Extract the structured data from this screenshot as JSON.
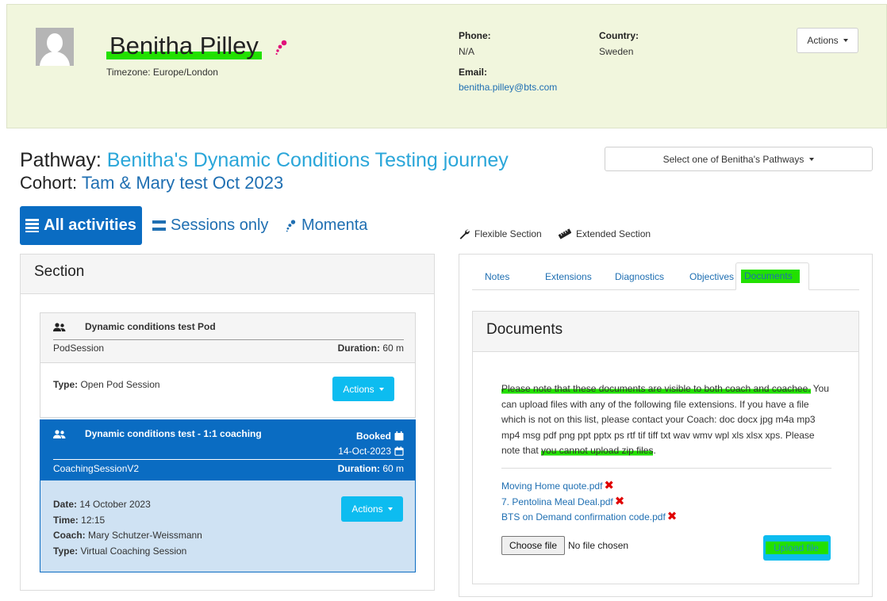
{
  "profile": {
    "name": "Benitha Pilley",
    "timezone": "Timezone: Europe/London",
    "phone_label": "Phone:",
    "phone_value": "N/A",
    "country_label": "Country:",
    "country_value": "Sweden",
    "email_label": "Email:",
    "email_value": "benitha.pilley@bts.com",
    "actions_label": "Actions"
  },
  "pathway": {
    "label": "Pathway:",
    "value": "Benitha's Dynamic Conditions Testing journey",
    "cohort_label": "Cohort:",
    "cohort_value": "Tam & Mary test Oct 2023",
    "select_label": "Select one of Benitha's Pathways"
  },
  "views": {
    "all": "All activities",
    "sessions": "Sessions only",
    "momenta": "Momenta"
  },
  "legend": {
    "flexible": "Flexible Section",
    "extended": "Extended Section"
  },
  "section": {
    "title": "Section",
    "cards": [
      {
        "title": "Dynamic conditions test Pod",
        "subtype": "PodSession",
        "duration_label": "Duration:",
        "duration_value": "60 m",
        "type_label": "Type:",
        "type_value": "Open Pod Session",
        "actions_label": "Actions"
      },
      {
        "title": "Dynamic conditions test - 1:1 coaching",
        "status": "Booked",
        "date": "14-Oct-2023",
        "subtype": "CoachingSessionV2",
        "duration_label": "Duration:",
        "duration_value": "60 m",
        "date_label": "Date:",
        "date_value": "14 October 2023",
        "time_label": "Time:",
        "time_value": "12:15",
        "coach_label": "Coach:",
        "coach_value": "Mary Schutzer-Weissmann",
        "type_label": "Type:",
        "type_value": "Virtual Coaching Session",
        "actions_label": "Actions"
      }
    ]
  },
  "tabs": [
    "Notes",
    "Extensions",
    "Diagnostics",
    "Objectives",
    "Documents"
  ],
  "documents": {
    "title": "Documents",
    "note_highlight": "Please note that these documents are visible to both coach and coachee.",
    "note_body": " You can upload files with any of the following file extensions. If you have a file which is not on this list, please contact your Coach: doc docx jpg m4a mp3 mp4 msg pdf png ppt pptx ps rtf tif tiff txt wav wmv wpl xls xlsx xps. Please note that ",
    "note_highlight2": "you cannot upload zip files",
    "note_end": ".",
    "files": [
      "Moving Home quote.pdf",
      "7. Pentolina Meal Deal.pdf",
      "BTS on Demand confirmation code.pdf"
    ],
    "choose_file": "Choose file",
    "no_file": "No file chosen",
    "upload": "Upload file"
  },
  "colors": {
    "header_bg": "#f1f6dd",
    "primary": "#0a6cc2",
    "accent": "#0dbcf0",
    "link": "#1f6fb2",
    "highlight": "#22e000",
    "pathway": "#2aa6d9",
    "momenta": "#e0127a"
  }
}
